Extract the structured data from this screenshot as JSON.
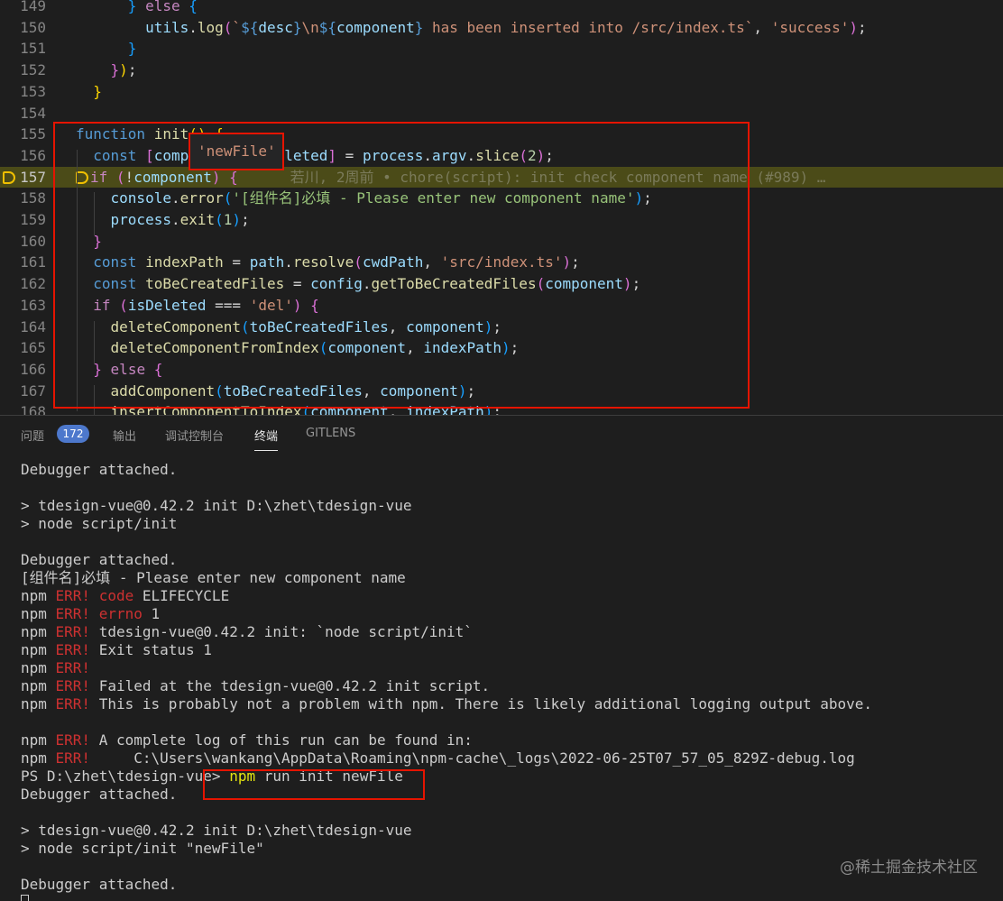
{
  "editor": {
    "lines": [
      {
        "n": "149",
        "tokens": [
          [
            "pun",
            "      "
          ],
          [
            "br3",
            "}"
          ],
          [
            "pun",
            " "
          ],
          [
            "kw2",
            "else"
          ],
          [
            "pun",
            " "
          ],
          [
            "br3",
            "{"
          ]
        ]
      },
      {
        "n": "150",
        "tokens": [
          [
            "pun",
            "        "
          ],
          [
            "var",
            "utils"
          ],
          [
            "pun",
            "."
          ],
          [
            "fn",
            "log"
          ],
          [
            "br2",
            "("
          ],
          [
            "tpl",
            "`"
          ],
          [
            "kw",
            "${"
          ],
          [
            "var",
            "desc"
          ],
          [
            "kw",
            "}"
          ],
          [
            "str",
            "\\n"
          ],
          [
            "kw",
            "${"
          ],
          [
            "var",
            "component"
          ],
          [
            "kw",
            "}"
          ],
          [
            "tpl",
            " has been inserted into /src/index.ts`"
          ],
          [
            "pun",
            ", "
          ],
          [
            "str",
            "'success'"
          ],
          [
            "br2",
            ")"
          ],
          [
            "pun",
            ";"
          ]
        ]
      },
      {
        "n": "151",
        "tokens": [
          [
            "pun",
            "      "
          ],
          [
            "br3",
            "}"
          ]
        ]
      },
      {
        "n": "152",
        "tokens": [
          [
            "pun",
            "    "
          ],
          [
            "br2",
            "}"
          ],
          [
            "br1",
            ")"
          ],
          [
            "pun",
            ";"
          ]
        ]
      },
      {
        "n": "153",
        "tokens": [
          [
            "pun",
            "  "
          ],
          [
            "br1",
            "}"
          ]
        ]
      },
      {
        "n": "154",
        "tokens": [
          [
            "pun",
            ""
          ]
        ]
      },
      {
        "n": "155",
        "tokens": [
          [
            "kw",
            "function"
          ],
          [
            "pun",
            " "
          ],
          [
            "fn",
            "init"
          ],
          [
            "br1",
            "()"
          ],
          [
            "pun",
            " "
          ],
          [
            "br1",
            "{"
          ]
        ]
      },
      {
        "n": "156",
        "tokens": [
          [
            "pun",
            "  "
          ],
          [
            "kw",
            "const"
          ],
          [
            "pun",
            " "
          ],
          [
            "br2",
            "["
          ],
          [
            "var",
            "component"
          ],
          [
            "pun",
            ", "
          ],
          [
            "var",
            "isDeleted"
          ],
          [
            "br2",
            "]"
          ],
          [
            "pun",
            " = "
          ],
          [
            "var",
            "process"
          ],
          [
            "pun",
            "."
          ],
          [
            "var",
            "argv"
          ],
          [
            "pun",
            "."
          ],
          [
            "fn",
            "slice"
          ],
          [
            "br2",
            "("
          ],
          [
            "num",
            "2"
          ],
          [
            "br2",
            ")"
          ],
          [
            "pun",
            ";"
          ]
        ]
      },
      {
        "n": "157",
        "tokens": [
          [
            "kw2",
            "if"
          ],
          [
            "pun",
            " "
          ],
          [
            "br2",
            "("
          ],
          [
            "pun",
            "!"
          ],
          [
            "var",
            "component"
          ],
          [
            "br2",
            ")"
          ],
          [
            "pun",
            " "
          ],
          [
            "br2",
            "{"
          ]
        ],
        "blame": "若川, 2周前 • chore(script): init check component name (#989) …"
      },
      {
        "n": "158",
        "tokens": [
          [
            "pun",
            "    "
          ],
          [
            "var",
            "console"
          ],
          [
            "pun",
            "."
          ],
          [
            "fn",
            "error"
          ],
          [
            "br3",
            "("
          ],
          [
            "str2",
            "'[组件名]必填 - Please enter new component name'"
          ],
          [
            "br3",
            ")"
          ],
          [
            "pun",
            ";"
          ]
        ]
      },
      {
        "n": "159",
        "tokens": [
          [
            "pun",
            "    "
          ],
          [
            "var",
            "process"
          ],
          [
            "pun",
            "."
          ],
          [
            "fn",
            "exit"
          ],
          [
            "br3",
            "("
          ],
          [
            "num",
            "1"
          ],
          [
            "br3",
            ")"
          ],
          [
            "pun",
            ";"
          ]
        ]
      },
      {
        "n": "160",
        "tokens": [
          [
            "pun",
            "  "
          ],
          [
            "br2",
            "}"
          ]
        ]
      },
      {
        "n": "161",
        "tokens": [
          [
            "pun",
            "  "
          ],
          [
            "kw",
            "const"
          ],
          [
            "pun",
            " "
          ],
          [
            "fn",
            "indexPath"
          ],
          [
            "pun",
            " = "
          ],
          [
            "var",
            "path"
          ],
          [
            "pun",
            "."
          ],
          [
            "fn",
            "resolve"
          ],
          [
            "br2",
            "("
          ],
          [
            "var",
            "cwdPath"
          ],
          [
            "pun",
            ", "
          ],
          [
            "str",
            "'src/index.ts'"
          ],
          [
            "br2",
            ")"
          ],
          [
            "pun",
            ";"
          ]
        ]
      },
      {
        "n": "162",
        "tokens": [
          [
            "pun",
            "  "
          ],
          [
            "kw",
            "const"
          ],
          [
            "pun",
            " "
          ],
          [
            "fn",
            "toBeCreatedFiles"
          ],
          [
            "pun",
            " = "
          ],
          [
            "var",
            "config"
          ],
          [
            "pun",
            "."
          ],
          [
            "fn",
            "getToBeCreatedFiles"
          ],
          [
            "br2",
            "("
          ],
          [
            "var",
            "component"
          ],
          [
            "br2",
            ")"
          ],
          [
            "pun",
            ";"
          ]
        ]
      },
      {
        "n": "163",
        "tokens": [
          [
            "pun",
            "  "
          ],
          [
            "kw2",
            "if"
          ],
          [
            "pun",
            " "
          ],
          [
            "br2",
            "("
          ],
          [
            "var",
            "isDeleted"
          ],
          [
            "pun",
            " === "
          ],
          [
            "str",
            "'del'"
          ],
          [
            "br2",
            ")"
          ],
          [
            "pun",
            " "
          ],
          [
            "br2",
            "{"
          ]
        ]
      },
      {
        "n": "164",
        "tokens": [
          [
            "pun",
            "    "
          ],
          [
            "fn",
            "deleteComponent"
          ],
          [
            "br3",
            "("
          ],
          [
            "var",
            "toBeCreatedFiles"
          ],
          [
            "pun",
            ", "
          ],
          [
            "var",
            "component"
          ],
          [
            "br3",
            ")"
          ],
          [
            "pun",
            ";"
          ]
        ]
      },
      {
        "n": "165",
        "tokens": [
          [
            "pun",
            "    "
          ],
          [
            "fn",
            "deleteComponentFromIndex"
          ],
          [
            "br3",
            "("
          ],
          [
            "var",
            "component"
          ],
          [
            "pun",
            ", "
          ],
          [
            "var",
            "indexPath"
          ],
          [
            "br3",
            ")"
          ],
          [
            "pun",
            ";"
          ]
        ]
      },
      {
        "n": "166",
        "tokens": [
          [
            "pun",
            "  "
          ],
          [
            "br2",
            "}"
          ],
          [
            "pun",
            " "
          ],
          [
            "kw2",
            "else"
          ],
          [
            "pun",
            " "
          ],
          [
            "br2",
            "{"
          ]
        ]
      },
      {
        "n": "167",
        "tokens": [
          [
            "pun",
            "    "
          ],
          [
            "fn",
            "addComponent"
          ],
          [
            "br3",
            "("
          ],
          [
            "var",
            "toBeCreatedFiles"
          ],
          [
            "pun",
            ", "
          ],
          [
            "var",
            "component"
          ],
          [
            "br3",
            ")"
          ],
          [
            "pun",
            ";"
          ]
        ]
      },
      {
        "n": "168",
        "tokens": [
          [
            "pun",
            "    "
          ],
          [
            "fn",
            "insertComponentToIndex"
          ],
          [
            "br3",
            "("
          ],
          [
            "var",
            "component"
          ],
          [
            "pun",
            ", "
          ],
          [
            "var",
            "indexPath"
          ],
          [
            "br3",
            ")"
          ],
          [
            "pun",
            ";"
          ]
        ]
      }
    ],
    "active_line": "157",
    "hover_value": "'newFile'"
  },
  "panel": {
    "tabs": [
      {
        "label": "问题",
        "active": false
      },
      {
        "label": "输出",
        "active": false
      },
      {
        "label": "调试控制台",
        "active": false
      },
      {
        "label": "终端",
        "active": true
      },
      {
        "label": "GITLENS",
        "active": false
      }
    ],
    "problems_count": "172"
  },
  "terminal": {
    "lines": [
      [
        [
          "",
          "Debugger attached."
        ]
      ],
      [
        [
          "",
          ""
        ]
      ],
      [
        [
          "",
          "> tdesign-vue@0.42.2 init D:\\zhet\\tdesign-vue"
        ]
      ],
      [
        [
          "",
          "> node script/init"
        ]
      ],
      [
        [
          "",
          ""
        ]
      ],
      [
        [
          "",
          "Debugger attached."
        ]
      ],
      [
        [
          "",
          "[组件名]必填 - Please enter new component name"
        ]
      ],
      [
        [
          "",
          "npm "
        ],
        [
          "err",
          "ERR!"
        ],
        [
          "",
          " "
        ],
        [
          "err",
          "code"
        ],
        [
          "",
          " ELIFECYCLE"
        ]
      ],
      [
        [
          "",
          "npm "
        ],
        [
          "err",
          "ERR!"
        ],
        [
          "",
          " "
        ],
        [
          "err",
          "errno"
        ],
        [
          "",
          " 1"
        ]
      ],
      [
        [
          "",
          "npm "
        ],
        [
          "err",
          "ERR!"
        ],
        [
          "",
          " tdesign-vue@0.42.2 init: `node script/init`"
        ]
      ],
      [
        [
          "",
          "npm "
        ],
        [
          "err",
          "ERR!"
        ],
        [
          "",
          " Exit status 1"
        ]
      ],
      [
        [
          "",
          "npm "
        ],
        [
          "err",
          "ERR!"
        ]
      ],
      [
        [
          "",
          "npm "
        ],
        [
          "err",
          "ERR!"
        ],
        [
          "",
          " Failed at the tdesign-vue@0.42.2 init script."
        ]
      ],
      [
        [
          "",
          "npm "
        ],
        [
          "err",
          "ERR!"
        ],
        [
          "",
          " This is probably not a problem with npm. There is likely additional logging output above."
        ]
      ],
      [
        [
          "",
          ""
        ]
      ],
      [
        [
          "",
          "npm "
        ],
        [
          "err",
          "ERR!"
        ],
        [
          "",
          " A complete log of this run can be found in:"
        ]
      ],
      [
        [
          "",
          "npm "
        ],
        [
          "err",
          "ERR!"
        ],
        [
          "",
          "     C:\\Users\\wankang\\AppData\\Roaming\\npm-cache\\_logs\\2022-06-25T07_57_05_829Z-debug.log"
        ]
      ],
      [
        [
          "",
          "PS D:\\zhet\\tdesign-vue> "
        ],
        [
          "npmcmd",
          "npm"
        ],
        [
          "",
          " run init newFile"
        ]
      ],
      [
        [
          "",
          "Debugger attached."
        ]
      ],
      [
        [
          "",
          ""
        ]
      ],
      [
        [
          "",
          "> tdesign-vue@0.42.2 init D:\\zhet\\tdesign-vue"
        ]
      ],
      [
        [
          "",
          "> node script/init \"newFile\""
        ]
      ],
      [
        [
          "",
          ""
        ]
      ],
      [
        [
          "",
          "Debugger attached."
        ]
      ]
    ]
  },
  "watermark": "@稀土掘金技术社区",
  "colors": {
    "background": "#1e1e1e",
    "highlight_line": "#4b4b18",
    "annotation_red": "#e51400",
    "badge_blue": "#4d78cc",
    "error_red": "#cd3131"
  }
}
